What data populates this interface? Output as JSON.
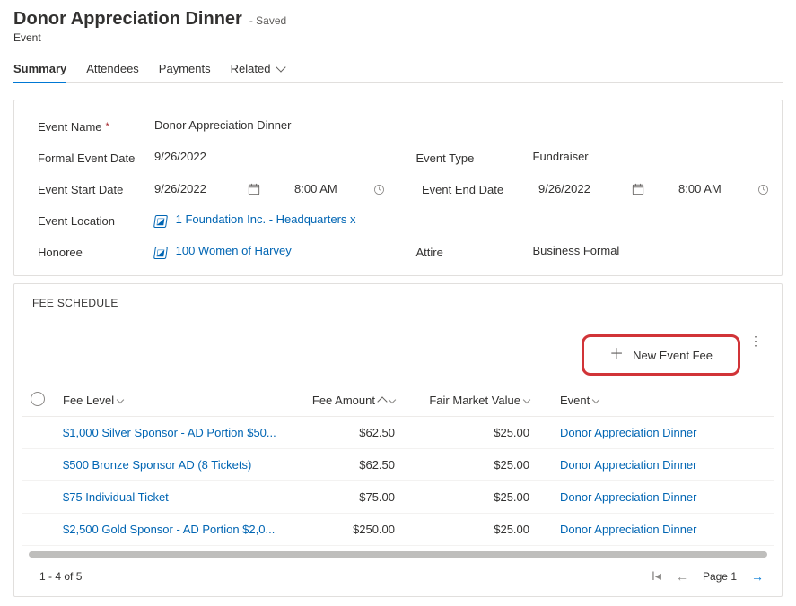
{
  "header": {
    "title": "Donor Appreciation Dinner",
    "saved_tag": "- Saved",
    "entity": "Event"
  },
  "tabs": {
    "summary": "Summary",
    "attendees": "Attendees",
    "payments": "Payments",
    "related": "Related"
  },
  "form": {
    "labels": {
      "name": "Event Name",
      "formal_date": "Formal Event Date",
      "start_date": "Event Start Date",
      "location": "Event Location",
      "honoree": "Honoree",
      "type": "Event Type",
      "end_date": "Event End Date",
      "attire": "Attire"
    },
    "values": {
      "name": "Donor Appreciation Dinner",
      "formal_date": "9/26/2022",
      "start_date": "9/26/2022",
      "start_time": "8:00 AM",
      "end_date": "9/26/2022",
      "end_time": "8:00 AM",
      "location": "1 Foundation Inc. - Headquarters x",
      "honoree": "100 Women of Harvey",
      "type": "Fundraiser",
      "attire": "Business Formal"
    }
  },
  "feeSchedule": {
    "title": "FEE SCHEDULE",
    "new_btn": "New Event Fee",
    "columns": {
      "level": "Fee Level",
      "amount": "Fee Amount",
      "fmv": "Fair Market Value",
      "event": "Event"
    },
    "rows": [
      {
        "level": "$1,000 Silver Sponsor - AD Portion $50...",
        "amount": "$62.50",
        "fmv": "$25.00",
        "event": "Donor Appreciation Dinner"
      },
      {
        "level": "$500 Bronze Sponsor AD (8 Tickets)",
        "amount": "$62.50",
        "fmv": "$25.00",
        "event": "Donor Appreciation Dinner"
      },
      {
        "level": "$75 Individual Ticket",
        "amount": "$75.00",
        "fmv": "$25.00",
        "event": "Donor Appreciation Dinner"
      },
      {
        "level": "$2,500 Gold Sponsor - AD Portion $2,0...",
        "amount": "$250.00",
        "fmv": "$25.00",
        "event": "Donor Appreciation Dinner"
      }
    ],
    "pager": {
      "range": "1 - 4 of 5",
      "page_label": "Page",
      "page_num": "1"
    }
  }
}
